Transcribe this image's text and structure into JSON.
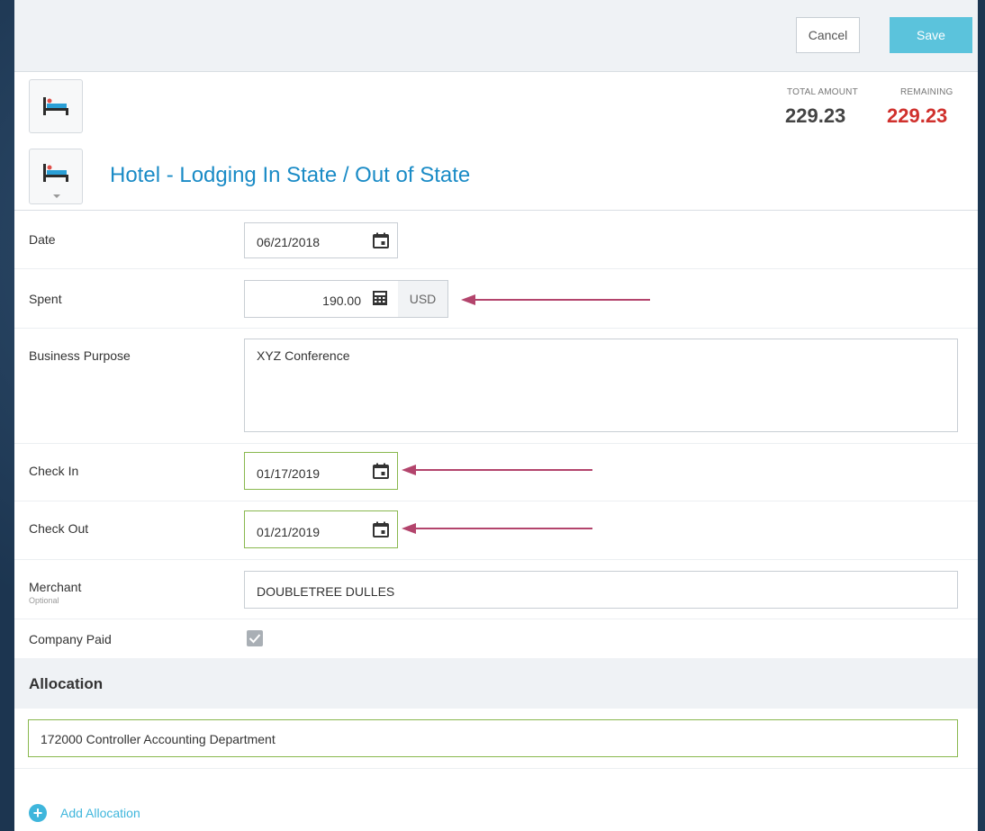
{
  "toolbar": {
    "cancel_label": "Cancel",
    "save_label": "Save"
  },
  "totals": {
    "total_label": "TOTAL AMOUNT",
    "total_value": "229.23",
    "remaining_label": "REMAINING",
    "remaining_value": "229.23",
    "remaining_color": "#d0312d"
  },
  "expense_type": {
    "icon": "bed-icon",
    "title": "Hotel - Lodging In State / Out of State"
  },
  "form": {
    "date": {
      "label": "Date",
      "value": "06/21/2018"
    },
    "spent": {
      "label": "Spent",
      "value": "190.00",
      "currency": "USD"
    },
    "business_purpose": {
      "label": "Business Purpose",
      "value": "XYZ Conference"
    },
    "check_in": {
      "label": "Check In",
      "value": "01/17/2019"
    },
    "check_out": {
      "label": "Check Out",
      "value": "01/21/2019"
    },
    "merchant": {
      "label": "Merchant",
      "sublabel": "Optional",
      "value": "DOUBLETREE DULLES"
    },
    "company_paid": {
      "label": "Company Paid",
      "checked": true
    }
  },
  "allocation": {
    "header": "Allocation",
    "value": "172000 Controller Accounting Department",
    "add_label": "Add Allocation"
  },
  "colors": {
    "accent": "#1a8bc6",
    "save_button": "#5bc3dc",
    "valid_border": "#89b84e",
    "annotation_arrow": "#b3446c"
  }
}
